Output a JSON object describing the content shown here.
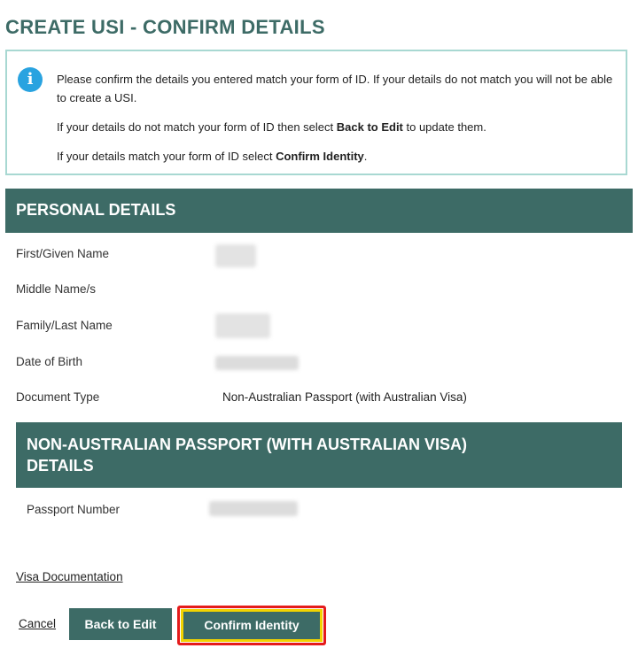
{
  "page": {
    "title": "CREATE USI - CONFIRM DETAILS"
  },
  "info": {
    "icon": "info-icon",
    "paragraph1": "Please confirm the details you entered match your form of ID. If your details do not match you will not be able to create a USI.",
    "paragraph2_prefix": "If your details do not match your form of ID then select ",
    "paragraph2_bold": "Back to Edit",
    "paragraph2_suffix": " to update them.",
    "paragraph3_prefix": "If your details match your form of ID select ",
    "paragraph3_bold": "Confirm Identity",
    "paragraph3_suffix": "."
  },
  "personal_details": {
    "header": "PERSONAL DETAILS",
    "fields": [
      {
        "label": "First/Given Name",
        "value": ""
      },
      {
        "label": "Middle Name/s",
        "value": ""
      },
      {
        "label": "Family/Last Name",
        "value": ""
      },
      {
        "label": "Date of Birth",
        "value": ""
      },
      {
        "label": "Document Type",
        "value": "Non-Australian Passport (with Australian Visa)"
      }
    ]
  },
  "passport_details": {
    "header_line1": "NON-AUSTRALIAN PASSPORT (WITH AUSTRALIAN VISA)",
    "header_line2": "DETAILS",
    "fields": [
      {
        "label": "Passport Number",
        "value": ""
      }
    ]
  },
  "links": {
    "visa_documentation": "Visa Documentation",
    "cancel": "Cancel"
  },
  "buttons": {
    "back_to_edit": "Back to Edit",
    "confirm_identity": "Confirm Identity"
  },
  "colors": {
    "header_bg": "#3d6b66",
    "info_border": "#a8d8d2",
    "info_icon": "#29a3e0",
    "highlight_red": "#e51b1b",
    "highlight_yellow": "#f2d300"
  }
}
